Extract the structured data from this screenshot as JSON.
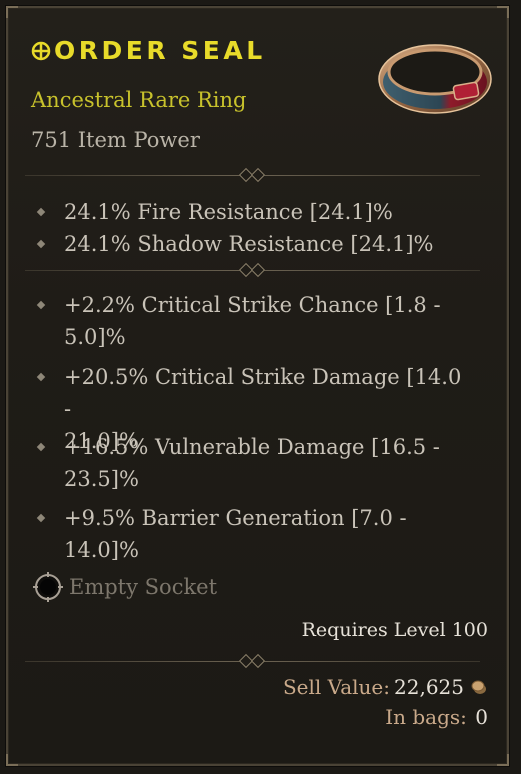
{
  "item": {
    "name": "ORDER SEAL",
    "type": "Ancestral Rare Ring",
    "item_power": "751 Item Power"
  },
  "implicits": [
    "24.1% Fire Resistance [24.1]%",
    "24.1% Shadow Resistance [24.1]%"
  ],
  "affixes": [
    {
      "line1": "+2.2% Critical Strike Chance [1.8 -",
      "line2": "5.0]%"
    },
    {
      "line1": "+20.5% Critical Strike Damage [14.0 -",
      "line2": "21.0]%"
    },
    {
      "line1": "+16.5% Vulnerable Damage [16.5 -",
      "line2": "23.5]%"
    },
    {
      "line1": "+9.5% Barrier Generation [7.0 -",
      "line2": "14.0]%"
    }
  ],
  "socket": {
    "label": "Empty Socket"
  },
  "requirement": "Requires Level 100",
  "sell": {
    "label": "Sell Value:",
    "value": "22,625"
  },
  "bags": {
    "label": "In bags:",
    "value": "0"
  },
  "colors": {
    "rare_title": "#e8db2a",
    "rare_type": "#c8c22c",
    "affix_text": "#c9c3b8",
    "muted": "#7d776c",
    "gold_label": "#c9a98a"
  },
  "icons": {
    "title_glyph": "crosshair-circle-icon",
    "item_image": "ring-icon",
    "socket": "empty-socket-icon",
    "currency": "gold-coin-icon"
  }
}
